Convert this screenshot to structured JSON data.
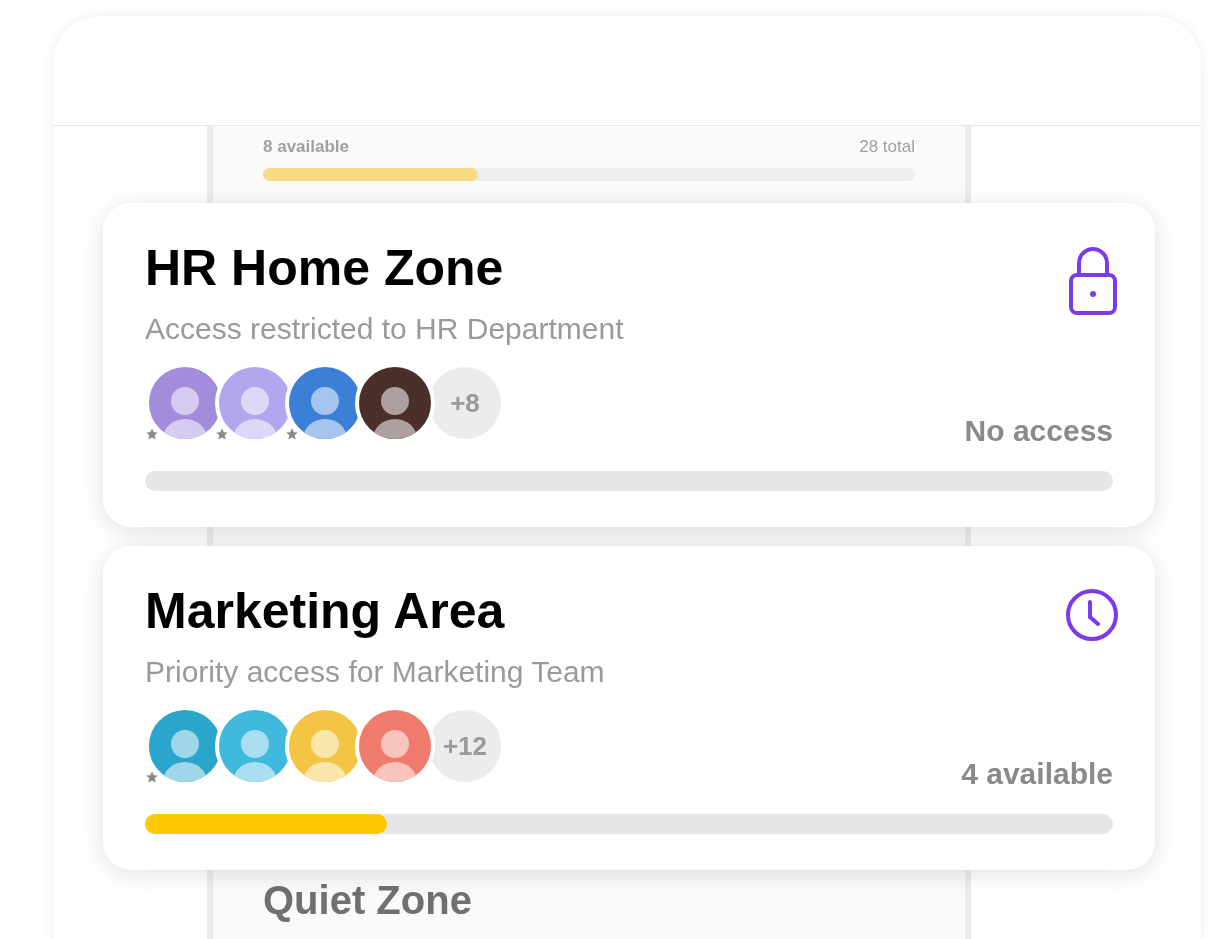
{
  "background_zones": [
    {
      "available": "8 available",
      "total": "28 total",
      "level": 0.33
    },
    {
      "title": "Quiet Zone"
    }
  ],
  "zones": [
    {
      "title": "HR Home Zone",
      "subtitle": "Access restricted to HR Department",
      "kind": "lock",
      "status": "No access",
      "level": 0,
      "more": "+8",
      "members": [
        {
          "color": "#a48cdc",
          "starred": true
        },
        {
          "color": "#b3a6ef",
          "starred": true
        },
        {
          "color": "#3b7fd6",
          "starred": true
        },
        {
          "color": "#4a2f2a",
          "starred": false
        }
      ]
    },
    {
      "title": "Marketing Area",
      "subtitle": "Priority access for Marketing Team",
      "kind": "clock",
      "status": "4 available",
      "level": 0.25,
      "more": "+12",
      "members": [
        {
          "color": "#2aa5cc",
          "starred": true
        },
        {
          "color": "#41b9dd",
          "starred": false
        },
        {
          "color": "#f4c545",
          "starred": false
        },
        {
          "color": "#ef7c6c",
          "starred": false
        }
      ]
    }
  ]
}
